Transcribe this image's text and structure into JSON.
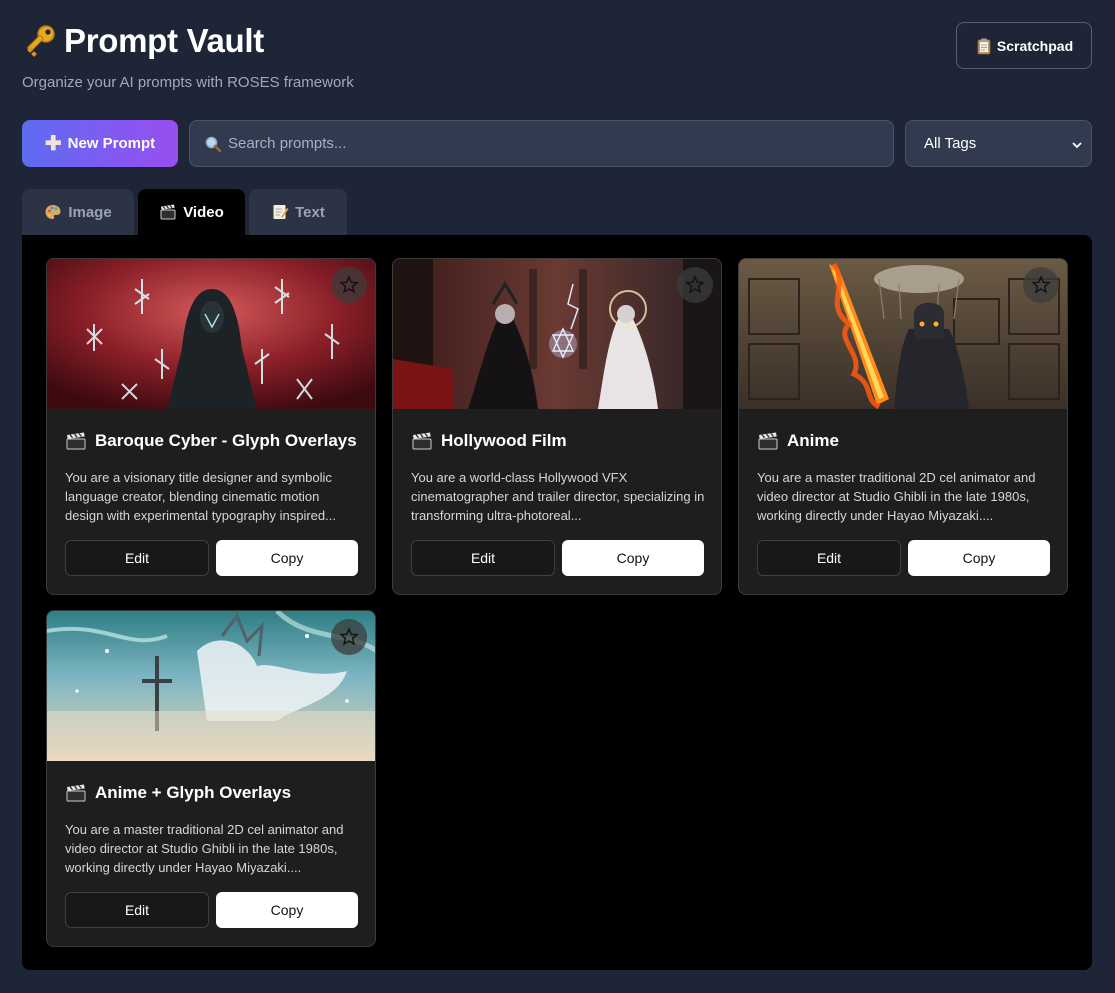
{
  "header": {
    "title": "Prompt Vault",
    "subtitle": "Organize your AI prompts with ROSES framework",
    "scratchpad_label": "Scratchpad"
  },
  "toolbar": {
    "new_prompt_label": "New Prompt",
    "search_placeholder": "Search prompts...",
    "tag_filter_value": "All Tags"
  },
  "tabs": [
    {
      "label": "Image",
      "icon": "palette-icon",
      "active": false
    },
    {
      "label": "Video",
      "icon": "clapperboard-icon",
      "active": true
    },
    {
      "label": "Text",
      "icon": "memo-icon",
      "active": false
    }
  ],
  "cards": [
    {
      "title": "Baroque Cyber - Glyph Overlays",
      "description": "You are a visionary title designer and symbolic language creator, blending cinematic motion design with experimental typography inspired...",
      "edit_label": "Edit",
      "copy_label": "Copy"
    },
    {
      "title": "Hollywood Film",
      "description": "You are a world-class Hollywood VFX cinematographer and trailer director, specializing in transforming ultra-photoreal...",
      "edit_label": "Edit",
      "copy_label": "Copy"
    },
    {
      "title": "Anime",
      "description": "You are a master traditional 2D cel animator and video director at Studio Ghibli in the late 1980s, working directly under Hayao Miyazaki....",
      "edit_label": "Edit",
      "copy_label": "Copy"
    },
    {
      "title": "Anime + Glyph Overlays",
      "description": "You are a master traditional 2D cel animator and video director at Studio Ghibli in the late 1980s, working directly under Hayao Miyazaki....",
      "edit_label": "Edit",
      "copy_label": "Copy"
    }
  ],
  "colors": {
    "background": "#1d2537",
    "panel": "#000000",
    "card": "#1e1e1e",
    "accent_gradient_start": "#5d6cf3",
    "accent_gradient_end": "#9a4ef0"
  }
}
